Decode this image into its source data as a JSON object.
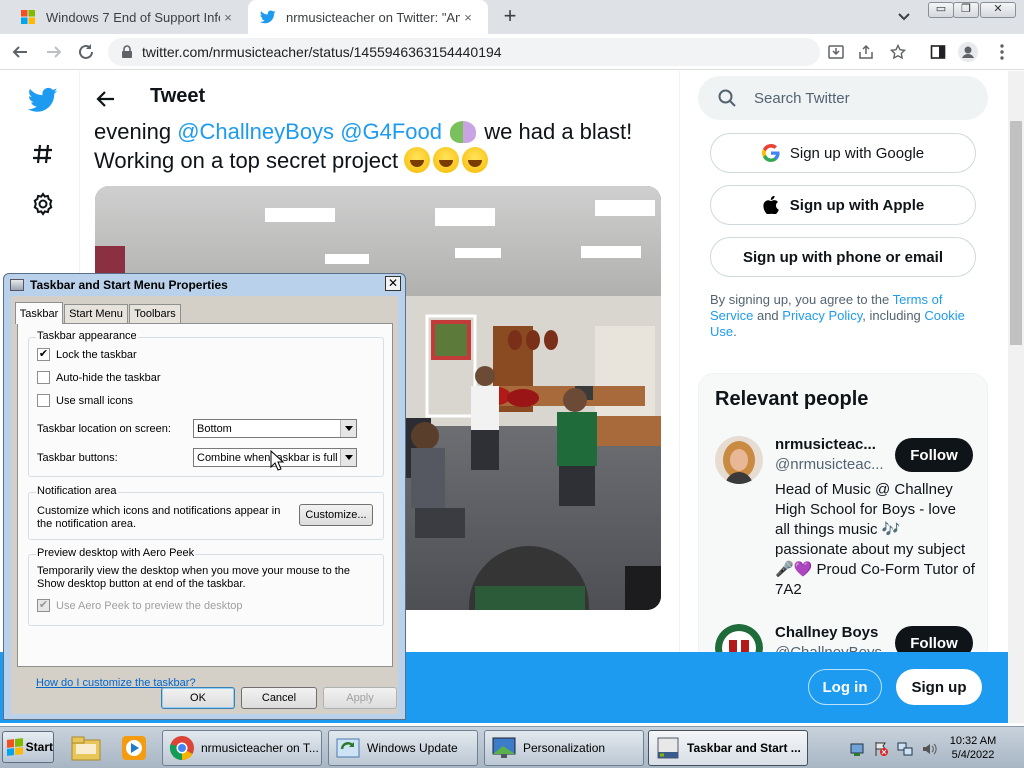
{
  "browser": {
    "tabs": [
      {
        "title": "Windows 7 End of Support Info",
        "favicon": "windows-logo-icon"
      },
      {
        "title": "nrmusicteacher on Twitter: \"Ama",
        "favicon": "twitter-bird-icon"
      }
    ],
    "close_glyph": "×",
    "new_tab_glyph": "+",
    "url": "twitter.com/nrmusicteacher/status/1455946363154440194",
    "window_buttons": [
      "▭",
      "❐",
      "✕"
    ]
  },
  "twitter": {
    "header_title": "Tweet",
    "tweet": {
      "lead": "evening",
      "mention1": "@ChallneyBoys",
      "mention2": "@G4Food",
      "rest1": "we had a blast!",
      "line2": "Working on a top secret project"
    },
    "search_placeholder": "Search Twitter",
    "signup": {
      "google": "Sign up with Google",
      "apple": "Sign up with Apple",
      "phone": "Sign up with phone or email",
      "legal_prefix": "By signing up, you agree to the ",
      "terms": "Terms of Service",
      "and": " and ",
      "privacy": "Privacy Policy",
      "including": ", including ",
      "cookie": "Cookie Use",
      "period": "."
    },
    "relevant": {
      "title": "Relevant people",
      "people": [
        {
          "name": "nrmusicteac...",
          "handle": "@nrmusicteac...",
          "bio": "Head of Music @ Challney High School for Boys - love all things music 🎶 passionate about my subject 🎤💜 Proud Co-Form Tutor of 7A2",
          "follow": "Follow"
        },
        {
          "name": "Challney Boys",
          "handle": "@ChallneyBoys",
          "follow": "Follow"
        }
      ]
    },
    "bottom": {
      "login": "Log in",
      "signup": "Sign up"
    },
    "colors": {
      "accent": "#1d9bf0",
      "text": "#0f1419",
      "muted": "#536471"
    }
  },
  "dialog": {
    "title": "Taskbar and Start Menu Properties",
    "close_glyph": "✕",
    "tabs": [
      "Taskbar",
      "Start Menu",
      "Toolbars"
    ],
    "appearance": {
      "label": "Taskbar appearance",
      "lock": {
        "label": "Lock the taskbar",
        "checked": "✔"
      },
      "autohide": {
        "label": "Auto-hide the taskbar",
        "checked": ""
      },
      "small": {
        "label": "Use small icons",
        "checked": ""
      },
      "location_label": "Taskbar location on screen:",
      "location_value": "Bottom",
      "buttons_label": "Taskbar buttons:",
      "buttons_value": "Combine when taskbar is full"
    },
    "notification": {
      "label": "Notification area",
      "text": "Customize which icons and notifications appear in the notification area.",
      "button": "Customize..."
    },
    "aero": {
      "label": "Preview desktop with Aero Peek",
      "text": "Temporarily view the desktop when you move your mouse to the Show desktop button at end of the taskbar.",
      "checkbox": "Use Aero Peek to preview the desktop",
      "checked": "✔"
    },
    "help_link": "How do I customize the taskbar?",
    "ok": "OK",
    "cancel": "Cancel",
    "apply": "Apply"
  },
  "taskbar": {
    "start": "Start",
    "items": [
      {
        "label": "nrmusicteacher on T...",
        "icon": "chrome-icon"
      },
      {
        "label": "Windows Update",
        "icon": "windows-update-icon"
      },
      {
        "label": "Personalization",
        "icon": "personalization-icon"
      },
      {
        "label": "Taskbar and Start ...",
        "icon": "taskbar-props-icon"
      }
    ],
    "time": "10:32 AM",
    "date": "5/4/2022"
  }
}
